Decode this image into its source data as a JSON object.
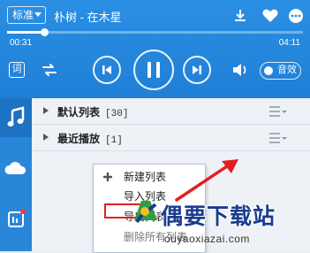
{
  "header": {
    "quality_label": "标准",
    "song_title": "朴树 - 在木星",
    "icons": [
      "download-icon",
      "heart-icon",
      "more-icon"
    ]
  },
  "progress": {
    "current_time": "00:31",
    "total_time": "04:11",
    "fraction": 0.124
  },
  "controls": {
    "lyric_label": "词",
    "effect_label": "音效",
    "icons": [
      "lyric-icon",
      "repeat-icon",
      "prev-icon",
      "pause-icon",
      "next-icon",
      "volume-icon"
    ]
  },
  "rail": {
    "items": [
      {
        "name": "music",
        "icon": "music-note-icon"
      },
      {
        "name": "cloud",
        "icon": "cloud-icon"
      },
      {
        "name": "radio",
        "icon": "radio-icon"
      }
    ]
  },
  "playlists": [
    {
      "name": "默认列表",
      "count": "[30]"
    },
    {
      "name": "最近播放",
      "count": "[1]"
    }
  ],
  "context_menu": {
    "items": [
      {
        "label": "新建列表"
      },
      {
        "label": "导入列表"
      },
      {
        "label": "导出列表"
      },
      {
        "label": "删除所有列表"
      }
    ]
  },
  "watermark": {
    "title": "偶要下载站",
    "url": "ouyaoxiazai.com"
  },
  "colors": {
    "primary": "#2b8fe3",
    "rail": "#2a86d8",
    "rail_active": "#1d72c2",
    "highlight": "#e02020"
  }
}
